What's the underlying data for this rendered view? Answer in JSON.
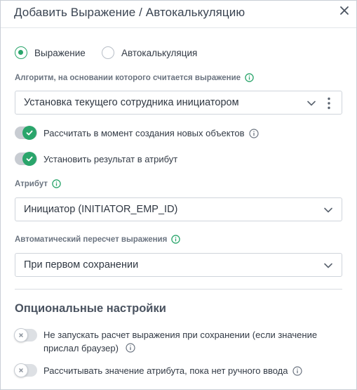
{
  "dialog": {
    "title": "Добавить Выражение / Автокалькуляцию",
    "close_icon": "close-icon"
  },
  "mode": {
    "options": [
      {
        "label": "Выражение",
        "checked": true
      },
      {
        "label": "Автокалькуляция",
        "checked": false
      }
    ]
  },
  "algorithm": {
    "label": "Алгоритм, на основании которого считается выражение",
    "value": "Установка текущего сотрудника инициатором"
  },
  "toggles": {
    "calc_on_create": {
      "label": "Рассчитать в момент создания новых объектов",
      "on": true
    },
    "set_result": {
      "label": "Установить результат в атрибут",
      "on": true
    }
  },
  "attribute": {
    "label": "Атрибут",
    "value": "Инициатор (INITIATOR_EMP_ID)"
  },
  "recalc": {
    "label": "Автоматический пересчет выражения",
    "value": "При первом сохранении"
  },
  "optional": {
    "title": "Опциональные настройки",
    "no_calc_on_save": {
      "label_line1": "Не запускать расчет выражения при сохранении (если значение",
      "label_line2": "прислал браузер)",
      "on": false
    },
    "calc_until_manual": {
      "label": "Рассчитывать значение атрибута, пока нет ручного ввода",
      "on": false
    }
  },
  "colors": {
    "accent": "#2aa56b",
    "border": "#cfd4db",
    "text": "#323a45",
    "muted_label": "#6b7480"
  }
}
